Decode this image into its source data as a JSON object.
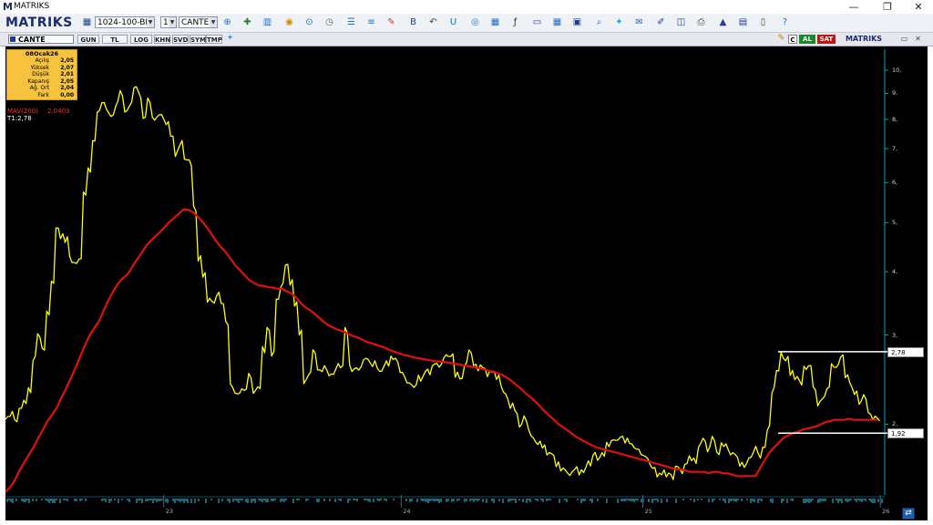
{
  "window": {
    "title": "MATRIKS",
    "logo": "M",
    "controls": {
      "minimize": "—",
      "restore": "❐",
      "close": "✕"
    }
  },
  "toolbar": {
    "brand": "MATRIKS",
    "template_select": "1024-100-BEYA",
    "count_select": "1",
    "symbol_select": "CANTE",
    "icons": [
      "save-icon",
      "zoom-icon",
      "crosshair-icon",
      "chart-type-icon",
      "palette-icon",
      "globe-icon",
      "clock-icon",
      "indicators-icon",
      "lines-icon",
      "draw-icon",
      "bold-icon",
      "undo-icon",
      "refresh-icon",
      "news-icon",
      "table-icon",
      "function-icon",
      "window-icon",
      "grid-icon",
      "book-icon",
      "search-icon",
      "twitter-icon",
      "comment-icon",
      "pen-icon",
      "window2-icon",
      "print-icon",
      "alarm-icon",
      "calculator-icon",
      "document-icon",
      "help-icon"
    ]
  },
  "chart_toolbar": {
    "symbol": "CANTE",
    "periods": [
      "GUN",
      "TL",
      "LOG",
      "KHN",
      "SVD",
      "SYM",
      "TMP"
    ],
    "right_buttons": {
      "c": "C",
      "buy": "AL",
      "sell": "SAT"
    },
    "brand": "MATRIKS"
  },
  "infobox": {
    "date": "08Ocak26",
    "rows": [
      {
        "label": "Açılış",
        "value": "2,05"
      },
      {
        "label": "Yüksek",
        "value": "2,07"
      },
      {
        "label": "Düşük",
        "value": "2,01"
      },
      {
        "label": "Kapanış",
        "value": "2,05"
      },
      {
        "label": "Ağ. Ort",
        "value": "2,04"
      },
      {
        "label": "Fark",
        "value": "0,00"
      }
    ]
  },
  "legend": {
    "ma_name": "MAV(200)",
    "ma_value": "2,0403",
    "t1": "T1:2,78"
  },
  "colors": {
    "background": "#000000",
    "price": "#ffff00",
    "ma": "#e01010",
    "axis": "#0aa0b4",
    "volume": "#22d3ee"
  },
  "chart_data": {
    "type": "line",
    "yscale": "log",
    "ylim": [
      1.45,
      11
    ],
    "y_ticks": [
      "10,",
      "9,",
      "8,",
      "7,",
      "6,",
      "5,",
      "4,",
      "3,",
      "2,"
    ],
    "x_ticks": [
      "23",
      "24",
      "25",
      "26"
    ],
    "series": [
      {
        "type": "price",
        "values": [
          2.06,
          2.1,
          2.03,
          2.15,
          2.21,
          2.33,
          2.7,
          2.99,
          2.81,
          3.31,
          3.81,
          4.88,
          4.71,
          4.64,
          4.22,
          4.16,
          4.24,
          5.7,
          6.34,
          7.25,
          8.3,
          8.63,
          8.29,
          8.14,
          8.6,
          8.99,
          8.3,
          8.58,
          9.26,
          8.91,
          8.06,
          8.7,
          8.01,
          8.13,
          8.07,
          7.87,
          7.41,
          6.86,
          7.2,
          6.66,
          6.56,
          5.32,
          4.26,
          3.95,
          3.52,
          3.48,
          3.62,
          3.46,
          3.16,
          2.38,
          2.3,
          2.33,
          2.34,
          2.49,
          2.32,
          2.36,
          2.8,
          3.08,
          2.76,
          3.53,
          3.77,
          4.13,
          3.82,
          3.46,
          3.04,
          2.43,
          2.52,
          2.78,
          2.56,
          2.58,
          2.52,
          2.51,
          2.61,
          2.6,
          3.06,
          2.57,
          2.58,
          2.58,
          2.69,
          2.66,
          2.64,
          2.56,
          2.58,
          2.63,
          2.7,
          2.67,
          2.53,
          2.44,
          2.4,
          2.38,
          2.46,
          2.52,
          2.53,
          2.62,
          2.61,
          2.67,
          2.73,
          2.74,
          2.51,
          2.46,
          2.63,
          2.78,
          2.62,
          2.59,
          2.58,
          2.52,
          2.54,
          2.48,
          2.34,
          2.26,
          2.18,
          2.11,
          1.99,
          2.05,
          1.92,
          1.86,
          1.84,
          1.81,
          1.75,
          1.74,
          1.67,
          1.63,
          1.61,
          1.6,
          1.64,
          1.61,
          1.63,
          1.67,
          1.75,
          1.71,
          1.74,
          1.82,
          1.86,
          1.86,
          1.89,
          1.86,
          1.83,
          1.79,
          1.76,
          1.73,
          1.68,
          1.64,
          1.59,
          1.61,
          1.59,
          1.57,
          1.65,
          1.61,
          1.67,
          1.71,
          1.69,
          1.82,
          1.86,
          1.79,
          1.87,
          1.75,
          1.82,
          1.8,
          1.75,
          1.73,
          1.67,
          1.66,
          1.72,
          1.79,
          1.73,
          1.8,
          1.97,
          2.34,
          2.55,
          2.73,
          2.7,
          2.53,
          2.47,
          2.41,
          2.58,
          2.61,
          2.35,
          2.2,
          2.26,
          2.36,
          2.61,
          2.61,
          2.73,
          2.49,
          2.38,
          2.31,
          2.21,
          2.26,
          2.1,
          2.06,
          2.04
        ]
      },
      {
        "type": "ma",
        "name": "MAV(200)",
        "values": [
          1.47,
          1.5,
          1.55,
          1.62,
          1.68,
          1.74,
          1.8,
          1.88,
          1.95,
          2.03,
          2.09,
          2.16,
          2.26,
          2.36,
          2.47,
          2.59,
          2.73,
          2.87,
          3.0,
          3.1,
          3.2,
          3.36,
          3.52,
          3.66,
          3.79,
          3.88,
          3.95,
          4.08,
          4.22,
          4.35,
          4.5,
          4.6,
          4.7,
          4.79,
          4.9,
          5.02,
          5.11,
          5.21,
          5.31,
          5.3,
          5.24,
          5.14,
          5.02,
          4.89,
          4.74,
          4.59,
          4.47,
          4.37,
          4.25,
          4.12,
          4.03,
          3.94,
          3.85,
          3.8,
          3.76,
          3.75,
          3.73,
          3.72,
          3.7,
          3.7,
          3.66,
          3.62,
          3.56,
          3.47,
          3.4,
          3.36,
          3.3,
          3.24,
          3.18,
          3.13,
          3.1,
          3.07,
          3.05,
          3.02,
          2.99,
          2.97,
          2.94,
          2.91,
          2.89,
          2.87,
          2.85,
          2.83,
          2.8,
          2.78,
          2.76,
          2.74,
          2.73,
          2.71,
          2.7,
          2.69,
          2.68,
          2.67,
          2.66,
          2.66,
          2.65,
          2.64,
          2.63,
          2.62,
          2.61,
          2.6,
          2.59,
          2.58,
          2.57,
          2.55,
          2.54,
          2.52,
          2.5,
          2.47,
          2.43,
          2.39,
          2.35,
          2.3,
          2.26,
          2.22,
          2.17,
          2.12,
          2.08,
          2.04,
          2.0,
          1.97,
          1.94,
          1.91,
          1.88,
          1.86,
          1.84,
          1.82,
          1.8,
          1.79,
          1.78,
          1.77,
          1.76,
          1.75,
          1.74,
          1.73,
          1.72,
          1.71,
          1.7,
          1.69,
          1.68,
          1.67,
          1.66,
          1.65,
          1.64,
          1.63,
          1.63,
          1.62,
          1.61,
          1.61,
          1.61,
          1.61,
          1.6,
          1.61,
          1.61,
          1.6,
          1.6,
          1.59,
          1.58,
          1.58,
          1.58,
          1.58,
          1.58,
          1.64,
          1.7,
          1.76,
          1.8,
          1.84,
          1.88,
          1.9,
          1.92,
          1.93,
          1.95,
          1.96,
          1.97,
          1.98,
          2.0,
          2.02,
          2.03,
          2.04,
          2.04,
          2.04,
          2.05,
          2.04,
          2.04,
          2.04,
          2.04,
          2.04,
          2.04
        ]
      }
    ],
    "levels": [
      {
        "label": "2,78",
        "value": 2.78
      },
      {
        "label": "1,92",
        "value": 1.92
      }
    ]
  }
}
